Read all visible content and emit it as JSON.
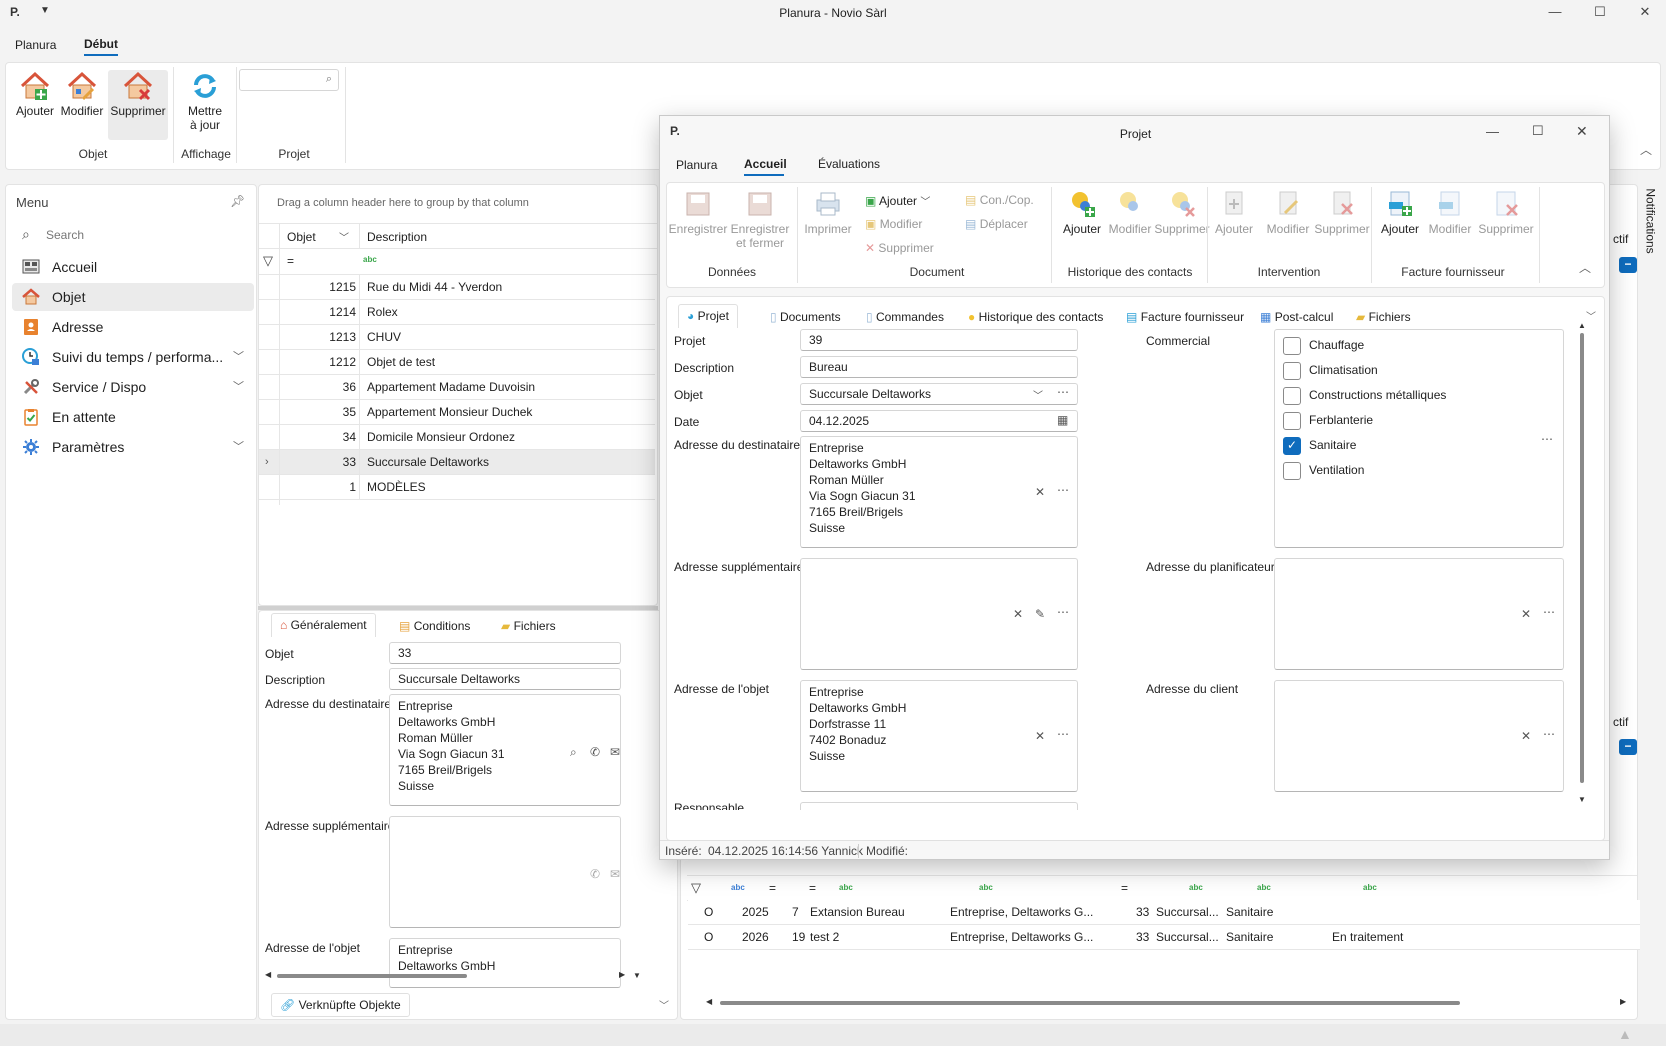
{
  "app": {
    "title": "Planura - Novio Sàrl",
    "tabs": [
      {
        "label": "Planura"
      },
      {
        "label": "Début"
      }
    ]
  },
  "ribbon": {
    "buttons": {
      "ajouter": "Ajouter",
      "modifier": "Modifier",
      "supprimer": "Supprimer",
      "mettre_line1": "Mettre",
      "mettre_line2": "à jour"
    },
    "groups": {
      "objet": "Objet",
      "affichage": "Affichage",
      "projet": "Projet"
    },
    "search_placeholder": ""
  },
  "sidebar": {
    "title": "Menu",
    "search_placeholder": "Search",
    "items": [
      {
        "label": "Accueil"
      },
      {
        "label": "Objet"
      },
      {
        "label": "Adresse"
      },
      {
        "label": "Suivi du temps / performa..."
      },
      {
        "label": "Service / Dispo"
      },
      {
        "label": "En attente"
      },
      {
        "label": "Paramètres"
      }
    ]
  },
  "notifications_label": "Notifications",
  "grid": {
    "group_hint": "Drag a column header here to group by that column",
    "columns": {
      "objet": "Objet",
      "description": "Description"
    },
    "filter_eq": "=",
    "rows": [
      {
        "id": "1215",
        "desc": "Rue du Midi 44 - Yverdon"
      },
      {
        "id": "1214",
        "desc": "Rolex"
      },
      {
        "id": "1213",
        "desc": "CHUV"
      },
      {
        "id": "1212",
        "desc": "Objet de test"
      },
      {
        "id": "36",
        "desc": "Appartement Madame Duvoisin"
      },
      {
        "id": "35",
        "desc": "Appartement Monsieur Duchek"
      },
      {
        "id": "34",
        "desc": "Domicile Monsieur Ordonez"
      },
      {
        "id": "33",
        "desc": "Succursale Deltaworks"
      },
      {
        "id": "1",
        "desc": "MODÈLES"
      }
    ]
  },
  "detail": {
    "tabs": {
      "general": "Généralement",
      "conditions": "Conditions",
      "fichiers": "Fichiers"
    },
    "labels": {
      "objet": "Objet",
      "description": "Description",
      "adresse_dest": "Adresse du destinataire",
      "adresse_supp": "Adresse supplémentaire",
      "adresse_objet": "Adresse de l'objet"
    },
    "values": {
      "objet": "33",
      "description": "Succursale Deltaworks",
      "adresse_dest": [
        "Entreprise",
        "Deltaworks GmbH",
        "Roman Müller",
        "Via Sogn Giacun 31",
        "7165 Breil/Brigels",
        "Suisse"
      ],
      "adresse_objet": [
        "Entreprise",
        "Deltaworks GmbH"
      ]
    },
    "linked": "Verknüpfte Objekte"
  },
  "bg_table": {
    "rows": [
      {
        "a": "O",
        "b": "2025",
        "c": "7",
        "d": "Extansion Bureau",
        "e": "Entreprise, Deltaworks G...",
        "f": "33",
        "g": "Succursal...",
        "h": "Sanitaire",
        "i": ""
      },
      {
        "a": "O",
        "b": "2026",
        "c": "19",
        "d": "test 2",
        "e": "Entreprise, Deltaworks G...",
        "f": "33",
        "g": "Succursal...",
        "h": "Sanitaire",
        "i": "En traitement"
      }
    ],
    "partial_header": "ctif"
  },
  "dialog": {
    "title": "Projet",
    "tabs": [
      {
        "label": "Planura"
      },
      {
        "label": "Accueil"
      },
      {
        "label": "Évaluations"
      }
    ],
    "ribbon": {
      "enregistrer": "Enregistrer",
      "enregistrer_fermer_1": "Enregistrer",
      "enregistrer_fermer_2": "et fermer",
      "imprimer": "Imprimer",
      "doc_ajouter": "Ajouter",
      "doc_modifier": "Modifier",
      "doc_supprimer": "Supprimer",
      "con_cop": "Con./Cop.",
      "deplacer": "Déplacer",
      "hc_ajouter": "Ajouter",
      "hc_modifier": "Modifier",
      "hc_supprimer": "Supprimer",
      "int_ajouter": "Ajouter",
      "int_modifier": "Modifier",
      "int_supprimer": "Supprimer",
      "ff_ajouter": "Ajouter",
      "ff_modifier": "Modifier",
      "ff_supprimer": "Supprimer",
      "groups": {
        "donnees": "Données",
        "document": "Document",
        "historique": "Historique des contacts",
        "intervention": "Intervention",
        "facture": "Facture fournisseur"
      }
    },
    "subtabs": [
      {
        "label": "Projet"
      },
      {
        "label": "Documents"
      },
      {
        "label": "Commandes"
      },
      {
        "label": "Historique des contacts"
      },
      {
        "label": "Facture fournisseur"
      },
      {
        "label": "Post-calcul"
      },
      {
        "label": "Fichiers"
      }
    ],
    "labels": {
      "projet": "Projet",
      "description": "Description",
      "objet": "Objet",
      "date": "Date",
      "adresse_dest": "Adresse du destinataire",
      "adresse_supp": "Adresse supplémentaire",
      "adresse_objet": "Adresse de l'objet",
      "responsable": "Responsable",
      "commercial": "Commercial",
      "adresse_plan": "Adresse du planificateur",
      "adresse_client": "Adresse du client"
    },
    "values": {
      "projet": "39",
      "description": "Bureau",
      "objet": "Succursale Deltaworks",
      "date": "04.12.2025",
      "adresse_dest": [
        "Entreprise",
        "Deltaworks GmbH",
        "Roman Müller",
        "Via Sogn Giacun 31",
        "7165 Breil/Brigels",
        "Suisse"
      ],
      "adresse_objet": [
        "Entreprise",
        "Deltaworks GmbH",
        "Dorfstrasse 11",
        "7402 Bonaduz",
        "Suisse"
      ]
    },
    "commercial_options": [
      {
        "label": "Chauffage",
        "checked": false
      },
      {
        "label": "Climatisation",
        "checked": false
      },
      {
        "label": "Constructions métalliques",
        "checked": false
      },
      {
        "label": "Ferblanterie",
        "checked": false
      },
      {
        "label": "Sanitaire",
        "checked": true
      },
      {
        "label": "Ventilation",
        "checked": false
      }
    ],
    "status": {
      "insere_label": "Inséré:",
      "insere_value": "04.12.2025 16:14:56 Yannick",
      "modifie_label": "Modifié:"
    }
  },
  "colors": {
    "accent": "#0f6cbd",
    "selection": "#ebebeb",
    "house_red": "#d8543a"
  }
}
